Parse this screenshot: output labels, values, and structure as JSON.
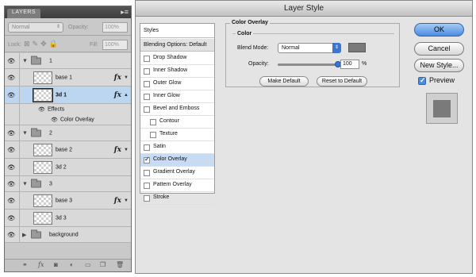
{
  "layers_panel": {
    "tab_label": "LAYERS",
    "menu_icon": "panel-menu-icon",
    "blend_mode": "Normal",
    "opacity_label": "Opacity:",
    "opacity_value": "100%",
    "lock_label": "Lock:",
    "fill_label": "Fill:",
    "fill_value": "100%",
    "rows": [
      {
        "type": "group",
        "name": "1"
      },
      {
        "type": "layer",
        "name": "base 1",
        "fx": "fx"
      },
      {
        "type": "layer",
        "name": "3d 1",
        "fx": "fx",
        "selected": true
      },
      {
        "type": "effects",
        "name": "Effects"
      },
      {
        "type": "effect",
        "name": "Color Overlay"
      },
      {
        "type": "group",
        "name": "2"
      },
      {
        "type": "layer",
        "name": "base 2",
        "fx": "fx"
      },
      {
        "type": "layer",
        "name": "3d 2"
      },
      {
        "type": "group",
        "name": "3"
      },
      {
        "type": "layer",
        "name": "base 3",
        "fx": "fx"
      },
      {
        "type": "layer",
        "name": "3d 3"
      },
      {
        "type": "group",
        "name": "background"
      }
    ],
    "bottom_icons": [
      "link-icon",
      "fx-icon",
      "mask-icon",
      "adjustment-icon",
      "new-group-icon",
      "new-layer-icon",
      "trash-icon"
    ]
  },
  "dialog": {
    "title": "Layer Style",
    "styles_header": "Styles",
    "blending_options": "Blending Options: Default",
    "style_items": [
      {
        "label": "Drop Shadow",
        "checked": false,
        "indent": false
      },
      {
        "label": "Inner Shadow",
        "checked": false,
        "indent": false
      },
      {
        "label": "Outer Glow",
        "checked": false,
        "indent": false
      },
      {
        "label": "Inner Glow",
        "checked": false,
        "indent": false
      },
      {
        "label": "Bevel and Emboss",
        "checked": false,
        "indent": false
      },
      {
        "label": "Contour",
        "checked": false,
        "indent": true
      },
      {
        "label": "Texture",
        "checked": false,
        "indent": true
      },
      {
        "label": "Satin",
        "checked": false,
        "indent": false
      },
      {
        "label": "Color Overlay",
        "checked": true,
        "indent": false,
        "active": true
      },
      {
        "label": "Gradient Overlay",
        "checked": false,
        "indent": false
      },
      {
        "label": "Pattern Overlay",
        "checked": false,
        "indent": false
      },
      {
        "label": "Stroke",
        "checked": false,
        "indent": false
      }
    ],
    "section_title": "Color Overlay",
    "subsection_title": "Color",
    "blend_mode_label": "Blend Mode:",
    "blend_mode_value": "Normal",
    "overlay_color": "#7a7a7a",
    "opacity_label": "Opacity:",
    "opacity_value": "100",
    "opacity_unit": "%",
    "opacity_fraction": 1.0,
    "make_default": "Make Default",
    "reset_default": "Reset to Default",
    "ok": "OK",
    "cancel": "Cancel",
    "new_style": "New Style...",
    "preview_label": "Preview",
    "preview_checked": true
  }
}
